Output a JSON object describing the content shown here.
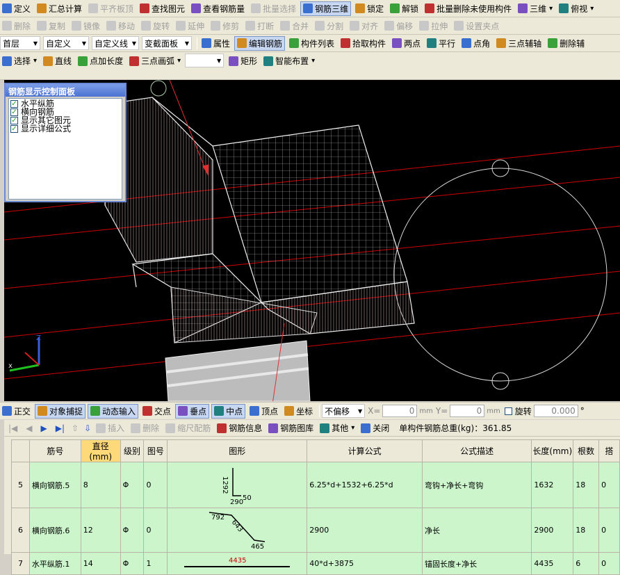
{
  "toolbar1": [
    {
      "label": "定义",
      "icon": "define-icon",
      "disabled": false
    },
    {
      "label": "汇总计算",
      "icon": "sigma-icon",
      "disabled": false
    },
    {
      "label": "平齐板顶",
      "icon": "flush-slab-icon",
      "disabled": true
    },
    {
      "label": "查找图元",
      "icon": "find-icon",
      "disabled": false
    },
    {
      "label": "查看钢筋量",
      "icon": "view-rebar-icon",
      "disabled": false
    },
    {
      "label": "批量选择",
      "icon": "batch-select-icon",
      "disabled": true
    },
    {
      "label": "钢筋三维",
      "icon": "rebar-3d-icon",
      "disabled": false,
      "pressed": true
    },
    {
      "label": "锁定",
      "icon": "lock-icon",
      "disabled": false
    },
    {
      "label": "解锁",
      "icon": "unlock-icon",
      "disabled": false
    },
    {
      "label": "批量删除未使用构件",
      "icon": "batch-delete-icon",
      "disabled": false
    },
    {
      "label": "三维",
      "icon": "3d-cube-icon",
      "disabled": false,
      "dropdown": true
    },
    {
      "label": "俯视",
      "icon": "top-view-icon",
      "disabled": false,
      "dropdown": true
    }
  ],
  "toolbar2": [
    {
      "label": "删除",
      "icon": "delete-icon"
    },
    {
      "label": "复制",
      "icon": "copy-icon"
    },
    {
      "label": "镜像",
      "icon": "mirror-icon"
    },
    {
      "label": "移动",
      "icon": "move-icon"
    },
    {
      "label": "旋转",
      "icon": "rotate-icon"
    },
    {
      "label": "延伸",
      "icon": "extend-icon"
    },
    {
      "label": "修剪",
      "icon": "trim-icon"
    },
    {
      "label": "打断",
      "icon": "break-icon"
    },
    {
      "label": "合并",
      "icon": "merge-icon"
    },
    {
      "label": "分割",
      "icon": "split-icon"
    },
    {
      "label": "对齐",
      "icon": "align-icon"
    },
    {
      "label": "偏移",
      "icon": "offset-icon"
    },
    {
      "label": "拉伸",
      "icon": "stretch-icon"
    },
    {
      "label": "设置夹点",
      "icon": "grip-icon"
    }
  ],
  "toolbar3": {
    "combos": [
      "首层",
      "自定义",
      "自定义线",
      "变截面板"
    ],
    "buttons": [
      {
        "label": "属性",
        "icon": "properties-icon"
      },
      {
        "label": "编辑钢筋",
        "icon": "edit-rebar-icon",
        "pressed": true
      },
      {
        "label": "构件列表",
        "icon": "component-list-icon"
      },
      {
        "label": "拾取构件",
        "icon": "pick-icon"
      },
      {
        "label": "两点",
        "icon": "two-point-icon"
      },
      {
        "label": "平行",
        "icon": "parallel-icon"
      },
      {
        "label": "点角",
        "icon": "point-angle-icon"
      },
      {
        "label": "三点辅轴",
        "icon": "three-point-axis-icon"
      },
      {
        "label": "删除辅",
        "icon": "delete-axis-icon"
      }
    ]
  },
  "toolbar4": [
    {
      "label": "选择",
      "icon": "cursor-icon",
      "dropdown": true
    },
    {
      "label": "直线",
      "icon": "line-icon"
    },
    {
      "label": "点加长度",
      "icon": "point-length-icon"
    },
    {
      "label": "三点画弧",
      "icon": "arc-icon",
      "dropdown": true
    },
    {
      "label": "矩形",
      "icon": "rectangle-icon"
    },
    {
      "label": "智能布置",
      "icon": "smart-layout-icon",
      "dropdown": true
    }
  ],
  "control_panel": {
    "title": "钢筋显示控制面板",
    "items": [
      "水平纵筋",
      "横向钢筋",
      "显示其它图元",
      "显示详细公式"
    ]
  },
  "status_bar": {
    "buttons": [
      "正交",
      "对象捕捉",
      "动态输入",
      "交点",
      "垂点",
      "中点",
      "顶点",
      "坐标"
    ],
    "offset_label": "不偏移",
    "x_label": "X=",
    "x_value": "0",
    "y_label": "Y=",
    "y_value": "0",
    "unit": "mm",
    "rotate_label": "旋转",
    "rotate_value": "0.000",
    "degree": "°"
  },
  "rebar_toolbar": {
    "buttons": [
      "插入",
      "删除",
      "缩尺配筋",
      "钢筋信息",
      "钢筋图库",
      "其他",
      "关闭"
    ],
    "total_label": "单构件钢筋总重(kg)：361.85"
  },
  "table": {
    "headers": [
      "筋号",
      "直径(mm)",
      "级别",
      "图号",
      "图形",
      "计算公式",
      "公式描述",
      "长度(mm)",
      "根数",
      "搭"
    ],
    "rows": [
      {
        "idx": "5",
        "name": "横向钢筋.5",
        "diameter": "8",
        "grade": "Φ",
        "fig": "0",
        "shape": {
          "a": "1292",
          "b": "290",
          "c": "50"
        },
        "formula": "6.25*d+1532+6.25*d",
        "desc": "弯钩+净长+弯钩",
        "length": "1632",
        "count": "18",
        "lap": "0"
      },
      {
        "idx": "6",
        "name": "横向钢筋.6",
        "diameter": "12",
        "grade": "Φ",
        "fig": "0",
        "shape": {
          "a": "792",
          "b": "643",
          "c": "465"
        },
        "formula": "2900",
        "desc": "净长",
        "length": "2900",
        "count": "18",
        "lap": "0"
      },
      {
        "idx": "7",
        "name": "水平纵筋.1",
        "diameter": "14",
        "grade": "Φ",
        "fig": "1",
        "shape": {
          "a": "4435"
        },
        "formula": "40*d+3875",
        "desc": "锚固长度+净长",
        "length": "4435",
        "count": "6",
        "lap": "0"
      }
    ]
  },
  "colors": {
    "accent": "#6a8ad8",
    "grid": "#c0c0c0",
    "axis": "#e00000",
    "row": "#ccf5cc",
    "header_hl": "#fdd97a"
  }
}
